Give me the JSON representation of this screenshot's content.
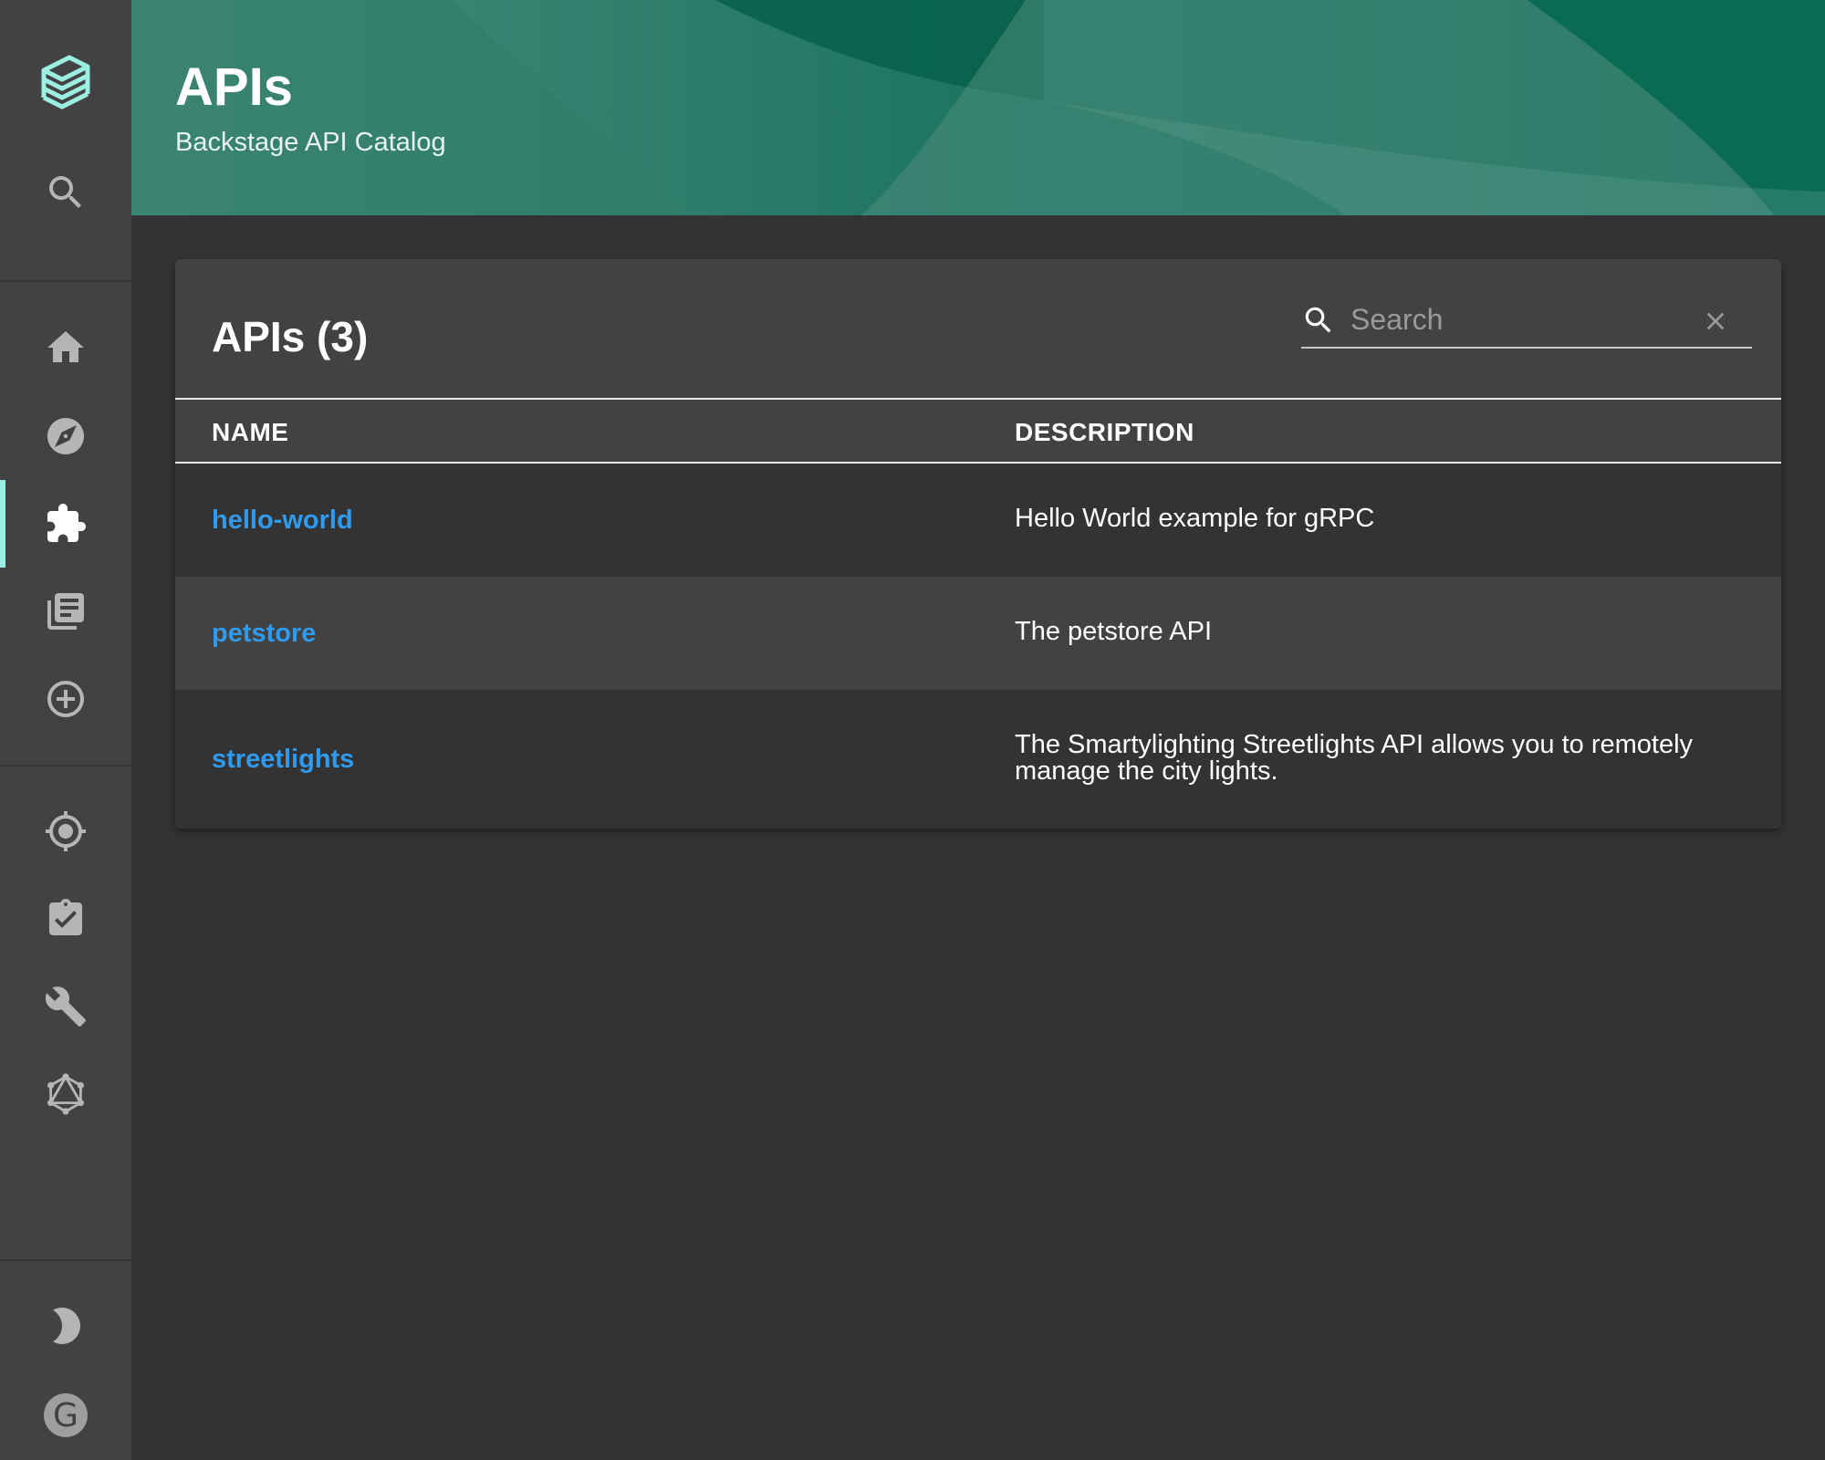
{
  "header": {
    "title": "APIs",
    "subtitle": "Backstage API Catalog",
    "colors": {
      "primary": "#0a6b53",
      "accent": "#9bf0e1"
    }
  },
  "sidebar": {
    "items": [
      {
        "icon": "logo-icon",
        "interactable": true
      },
      {
        "icon": "search-icon"
      },
      {
        "icon": "home-icon"
      },
      {
        "icon": "compass-icon"
      },
      {
        "icon": "puzzle-icon",
        "active": true
      },
      {
        "icon": "docs-icon"
      },
      {
        "icon": "add-circle-icon"
      },
      {
        "icon": "target-icon"
      },
      {
        "icon": "clipboard-check-icon"
      },
      {
        "icon": "wrench-icon"
      },
      {
        "icon": "graphql-icon"
      },
      {
        "icon": "moon-icon"
      }
    ],
    "avatar_letter": "G"
  },
  "card": {
    "title": "APIs (3)",
    "search": {
      "placeholder": "Search",
      "value": ""
    },
    "columns": [
      "NAME",
      "DESCRIPTION"
    ],
    "rows": [
      {
        "name": "hello-world",
        "description": "Hello World example for gRPC"
      },
      {
        "name": "petstore",
        "description": "The petstore API"
      },
      {
        "name": "streetlights",
        "description": "The Smartylighting Streetlights API allows you to remotely manage the city lights."
      }
    ],
    "link_color": "#2f9bf0"
  }
}
